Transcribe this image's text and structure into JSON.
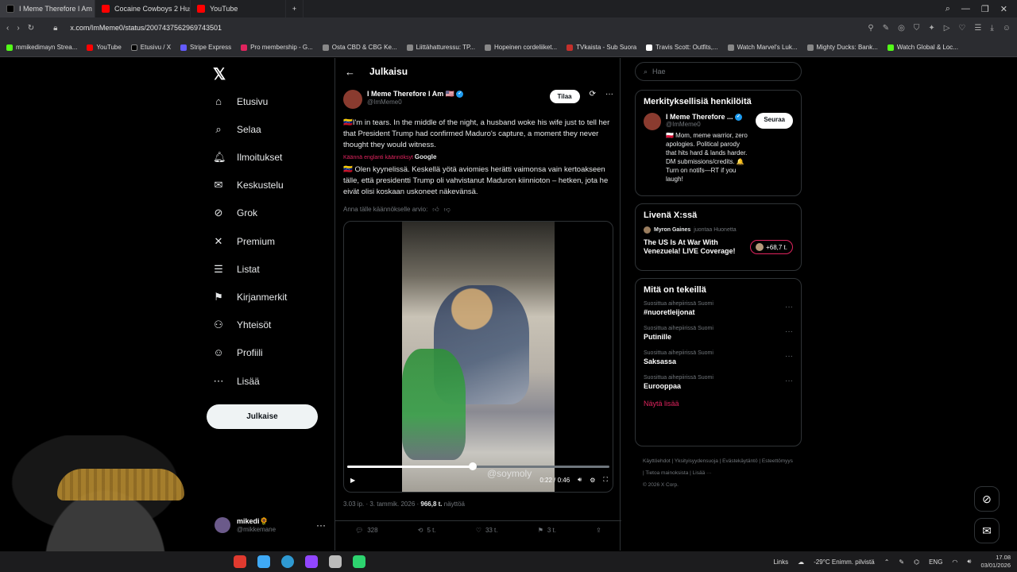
{
  "browser": {
    "tabs": [
      {
        "label": "I Meme Therefore I Am ☺",
        "active": true,
        "color": "#e7e9ea"
      },
      {
        "label": "Cocaine Cowboys 2 Hustl",
        "active": false,
        "color": "#ff0000"
      },
      {
        "label": "YouTube",
        "active": false,
        "color": "#ff0000"
      }
    ],
    "url": "x.com/ImMeme0/status/2007437562969743501",
    "bookmarks": [
      "mmikedimayn Strea...",
      "YouTube",
      "Etusivu / X",
      "Stripe Express",
      "Pro membership - G...",
      "Osta CBD & CBG Ke...",
      "Liittähatturessu: TP...",
      "Hopeinen cordeliiket...",
      "TVkaista - Sub Suora",
      "Travis Scott: Outfits,...",
      "Watch Marvel's Luk...",
      "Mighty Ducks: Bank...",
      "Watch Global & Loc..."
    ]
  },
  "nav": {
    "items": [
      {
        "label": "Etusivu",
        "icon": "home-icon",
        "glyph": "⌂"
      },
      {
        "label": "Selaa",
        "icon": "search-icon",
        "glyph": "⌕"
      },
      {
        "label": "Ilmoitukset",
        "icon": "bell-icon",
        "glyph": "🔔︎"
      },
      {
        "label": "Keskustelu",
        "icon": "mail-icon",
        "glyph": "✉"
      },
      {
        "label": "Grok",
        "icon": "grok-icon",
        "glyph": "⊘"
      },
      {
        "label": "Premium",
        "icon": "x-premium-icon",
        "glyph": "✕"
      },
      {
        "label": "Listat",
        "icon": "list-icon",
        "glyph": "☰"
      },
      {
        "label": "Kirjanmerkit",
        "icon": "bookmark-icon",
        "glyph": "⚑"
      },
      {
        "label": "Yhteisöt",
        "icon": "communities-icon",
        "glyph": "⚇"
      },
      {
        "label": "Profiili",
        "icon": "profile-icon",
        "glyph": "☺"
      },
      {
        "label": "Lisää",
        "icon": "more-icon",
        "glyph": "⋯"
      }
    ],
    "post_button": "Julkaise",
    "me_name": "mikedi🌻",
    "me_handle": "@mikkemane"
  },
  "main": {
    "header_title": "Julkaisu",
    "author_name": "I Meme Therefore I Am 🇺🇸",
    "author_handle": "@ImMeme0",
    "subscribe": "Tilaa",
    "text": "🇻🇪I'm in tears. In the middle of the night, a husband woke his wife just to tell her that President Trump had confirmed Maduro's capture, a moment they never thought they would witness.",
    "translated_label": "Käännä englanti käännöksyt",
    "translated_by": "Google",
    "translated_text": "🇻🇪 Olen kyynelissä. Keskellä yötä aviomies herätti vaimonsa vain kertoakseen tälle, että presidentti Trump oli vahvistanut Maduron kiinnioton – hetken, jota he eivät olisi koskaan uskoneet näkevänsä.",
    "rate_label": "Anna tälle käännökselle arvio:",
    "video": {
      "watermark": "@soymoly",
      "time": "0:22 / 0:46",
      "progress": 0.478
    },
    "meta_time": "3.03 ip. · 3. tammik. 2026 · ",
    "meta_views": "966,8 t.",
    "meta_views_label": " näyttöä",
    "actions": [
      {
        "icon": "reply-icon",
        "glyph": "💬︎",
        "count": "328"
      },
      {
        "icon": "repost-icon",
        "glyph": "⟲",
        "count": "5 t."
      },
      {
        "icon": "like-icon",
        "glyph": "♡",
        "count": "33 t."
      },
      {
        "icon": "bookmark-icon",
        "glyph": "⚑",
        "count": "3 t."
      },
      {
        "icon": "share-icon",
        "glyph": "⇪",
        "count": ""
      }
    ]
  },
  "right": {
    "search_placeholder": "Hae",
    "who_title": "Merkityksellisiä henkilöitä",
    "who_name": "I Meme Therefore ...",
    "who_handle": "@ImMeme0",
    "who_follow": "Seuraa",
    "who_bio": "🇵🇱 Mom, meme warrior, zero apologies. Political parody that hits hard & lands harder. DM submissions/credits. 🔔 Turn on notifs—RT if you laugh!",
    "live_title_header": "Livenä X:ssä",
    "live_host": "Myron Gaines",
    "live_host_suffix": "juontaa Huonetta",
    "live_title": "The US Is At War With Venezuela! LIVE Coverage!",
    "live_count": "+68,7 t.",
    "trends_title": "Mitä on tekeillä",
    "trends": [
      {
        "context": "Suosittua aihepiirissä Suomi",
        "name": "#nuoretleijonat"
      },
      {
        "context": "Suosittua aihepiirissä Suomi",
        "name": "Putinille"
      },
      {
        "context": "Suosittua aihepiirissä Suomi",
        "name": "Saksassa"
      },
      {
        "context": "Suosittua aihepiirissä Suomi",
        "name": "Eurooppaa"
      }
    ],
    "show_more": "Näytä lisää",
    "footer": [
      "Käyttöehdot",
      "Yksityisyydensuoja",
      "Evästekäytäntö",
      "Esteettömyys",
      "Tietoa mainoksista",
      "Lisää ···",
      "© 2026 X Corp."
    ]
  },
  "taskbar": {
    "links": "Links",
    "weather": "-29°C  Enimm. pilvistä",
    "lang": "ENG",
    "time": "17.08",
    "date": "03/01/2026"
  }
}
